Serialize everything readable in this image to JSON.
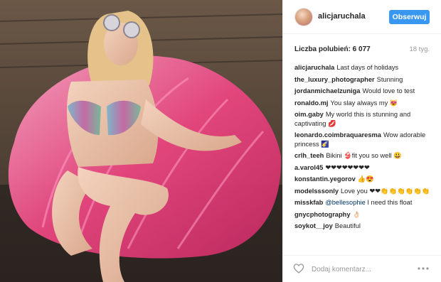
{
  "post": {
    "image_alt": "Woman in sunglasses and bikini sitting in a pink inflatable shell float"
  },
  "header": {
    "username": "alicjaruchala",
    "follow_label": "Obserwuj"
  },
  "stats": {
    "likes_label": "Liczba polubień: 6 077",
    "time_label": "18 tyg."
  },
  "comments": [
    {
      "user": "alicjaruchala",
      "text": "Last days of holidays"
    },
    {
      "user": "the_luxury_photographer",
      "text": "Stunning"
    },
    {
      "user": "jordanmichaelzuniga",
      "text": "Would love to test"
    },
    {
      "user": "ronaldo.mj",
      "text": "You slay always my 😻"
    },
    {
      "user": "oim.gaby",
      "text": "My world this is stunning and captivating 💋"
    },
    {
      "user": "leonardo.coimbraquaresma",
      "text": "Wow adorable princess 🌠"
    },
    {
      "user": "crlh_teeh",
      "text": "Bikini 👙fit you so well 😃"
    },
    {
      "user": "a.varol45",
      "text": "❤❤❤❤❤❤❤❤"
    },
    {
      "user": "konstantin.yegorov",
      "text": "👍😍"
    },
    {
      "user": "modelsssonly",
      "text": "Love you ❤❤👏👏👏👏👏👏"
    },
    {
      "user": "misskfab",
      "mention": "@bellesophie",
      "text": " I need this float"
    },
    {
      "user": "gnycphotography",
      "text": "👌🏻"
    },
    {
      "user": "soykot__joy",
      "text": "Beautiful"
    }
  ],
  "footer": {
    "comment_placeholder": "Dodaj komentarz..."
  }
}
